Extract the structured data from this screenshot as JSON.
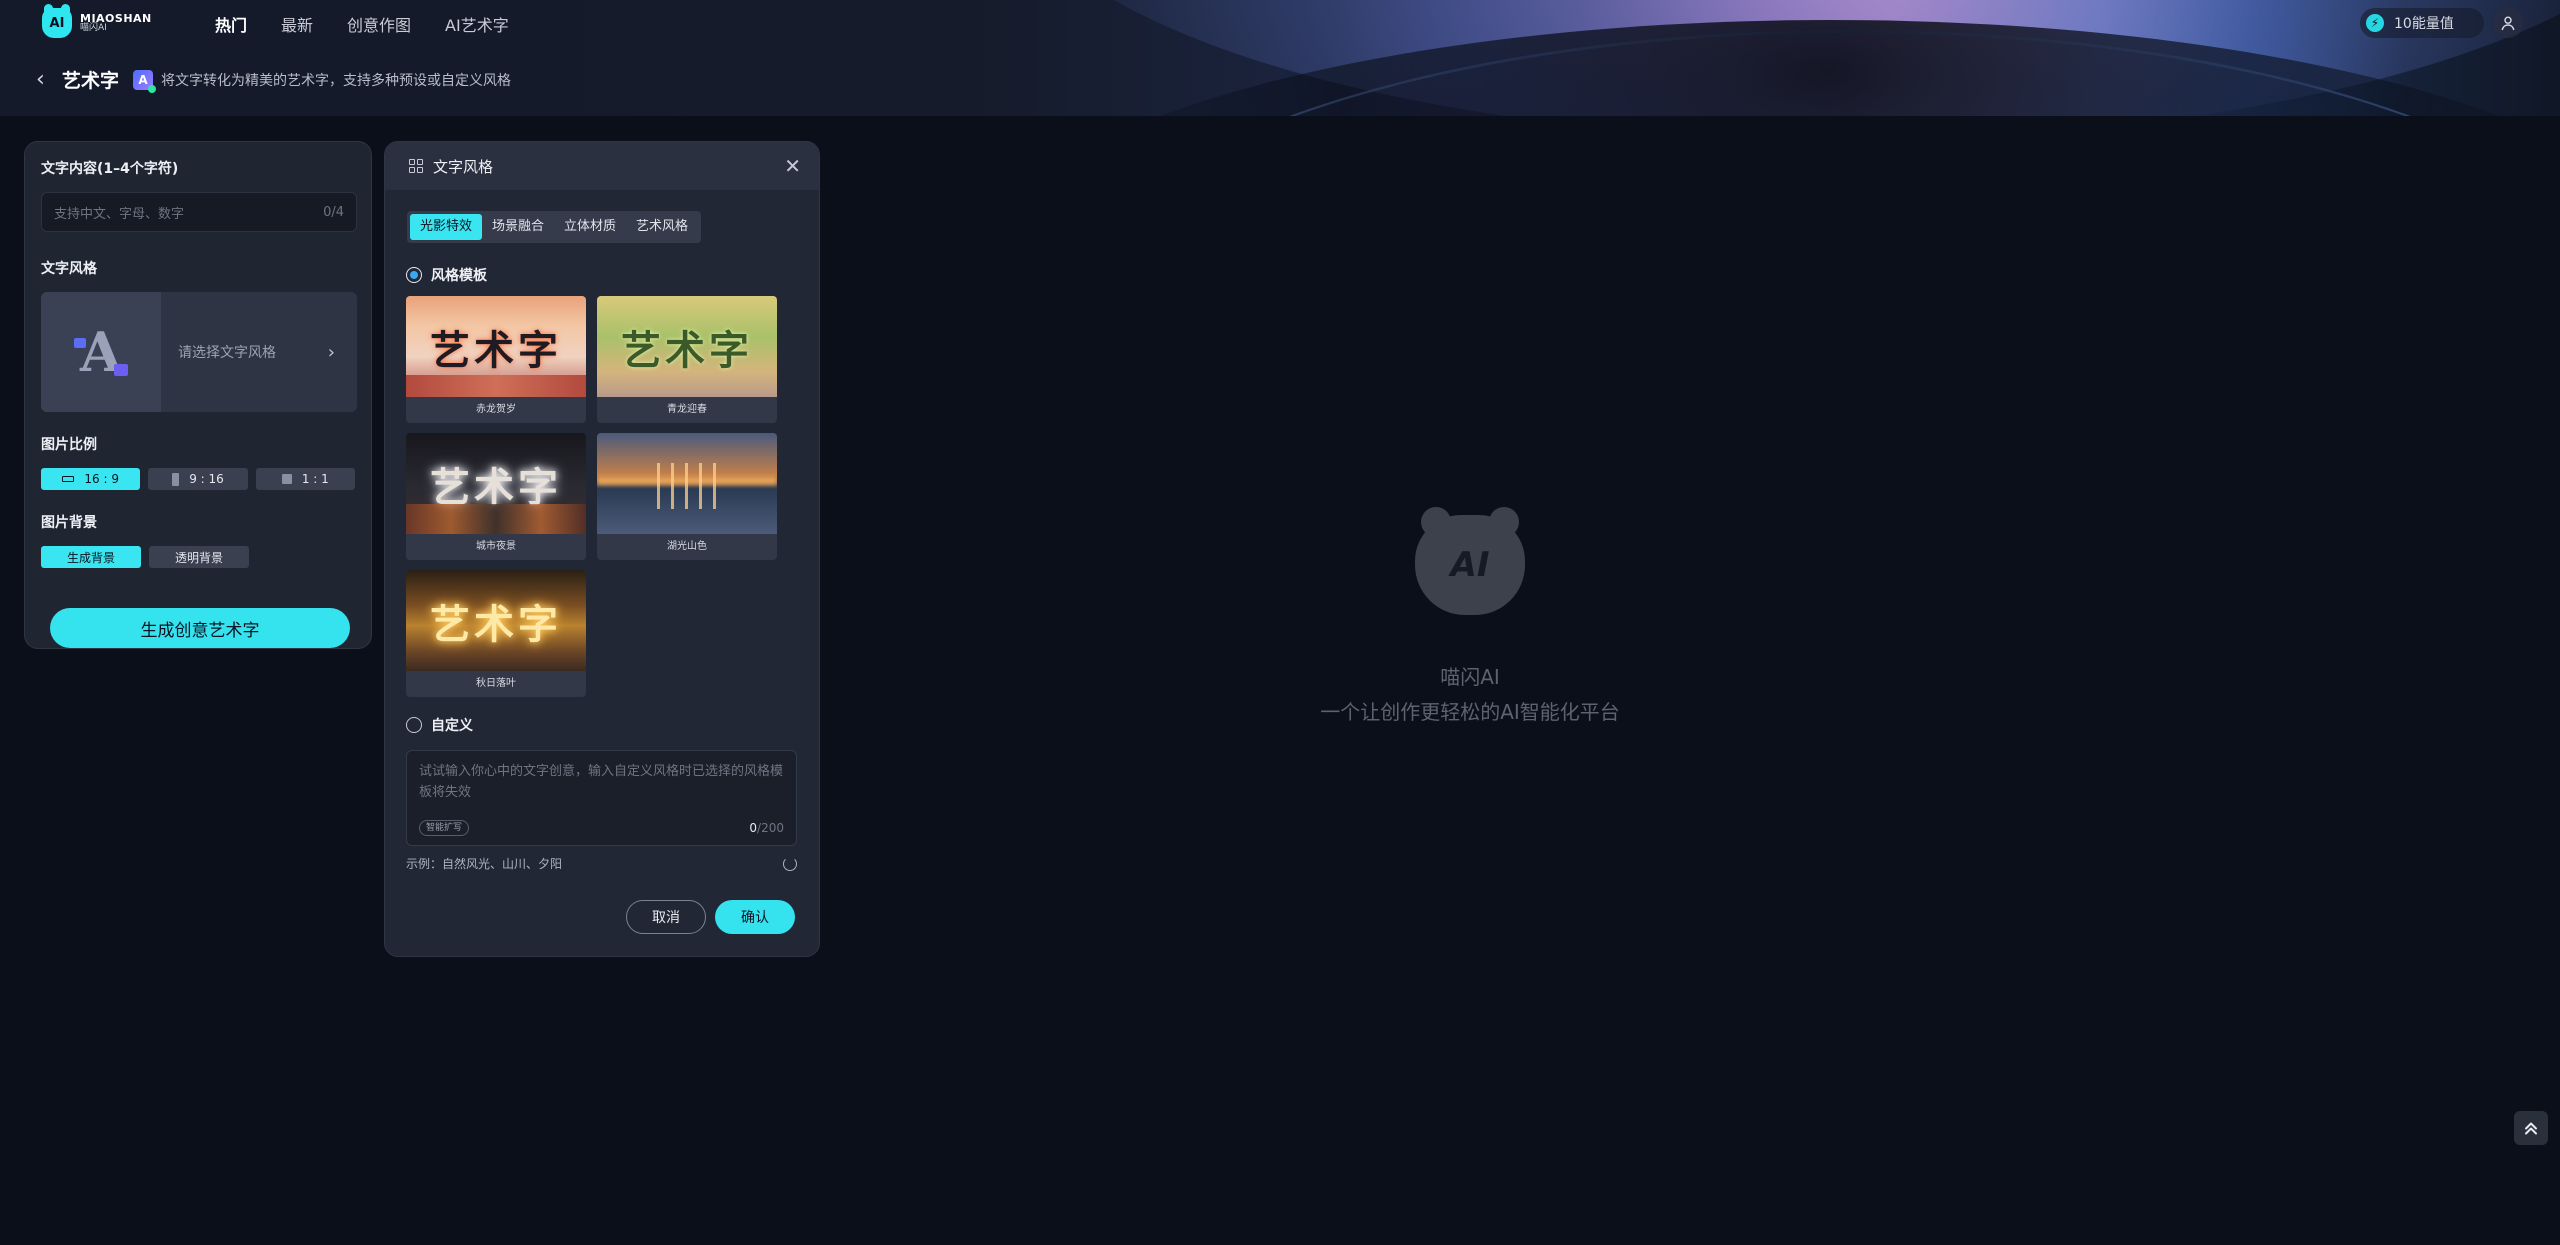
{
  "header": {
    "logo": {
      "mark": "AI",
      "name_en": "MIAOSHAN",
      "name_cn": "喵闪AI"
    },
    "nav": [
      "热门",
      "最新",
      "创意作图",
      "AI艺术字"
    ],
    "energy_label": "10能量值"
  },
  "subbar": {
    "title": "艺术字",
    "description": "将文字转化为精美的艺术字，支持多种预设或自定义风格"
  },
  "left_panel": {
    "text_label": "文字内容(1–4个字符)",
    "text_placeholder": "支持中文、字母、数字",
    "text_count": "0/4",
    "style_label": "文字风格",
    "style_placeholder": "请选择文字风格",
    "ratio_label": "图片比例",
    "ratios": [
      "16 : 9",
      "9 : 16",
      "1 : 1"
    ],
    "bg_label": "图片背景",
    "bg_options": [
      "生成背景",
      "透明背景"
    ],
    "generate_button": "生成创意艺术字"
  },
  "dialog": {
    "title": "文字风格",
    "tabs": [
      "光影特效",
      "场景融合",
      "立体材质",
      "艺术风格"
    ],
    "preset_label": "风格模板",
    "templates": [
      {
        "glyph": "艺术字",
        "caption": "赤龙贺岁"
      },
      {
        "glyph": "艺术字",
        "caption": "青龙迎春"
      },
      {
        "glyph": "艺术字",
        "caption": "城市夜景"
      },
      {
        "glyph": "",
        "caption": "湖光山色"
      },
      {
        "glyph": "艺术字",
        "caption": "秋日落叶"
      }
    ],
    "custom_label": "自定义",
    "custom_placeholder": "试试输入你心中的文字创意，输入自定义风格时已选择的风格模板将失效",
    "smart_expand": "智能扩写",
    "count_current": "0",
    "count_max": "/200",
    "example": "示例：自然风光、山川、夕阳",
    "cancel": "取消",
    "confirm": "确认"
  },
  "empty_state": {
    "logo_text": "AI",
    "name": "喵闪AI",
    "slogan": "一个让创作更轻松的AI智能化平台"
  },
  "colors": {
    "accent": "#35e3ef",
    "background": "#0b0f1a",
    "panel": "#202532"
  }
}
